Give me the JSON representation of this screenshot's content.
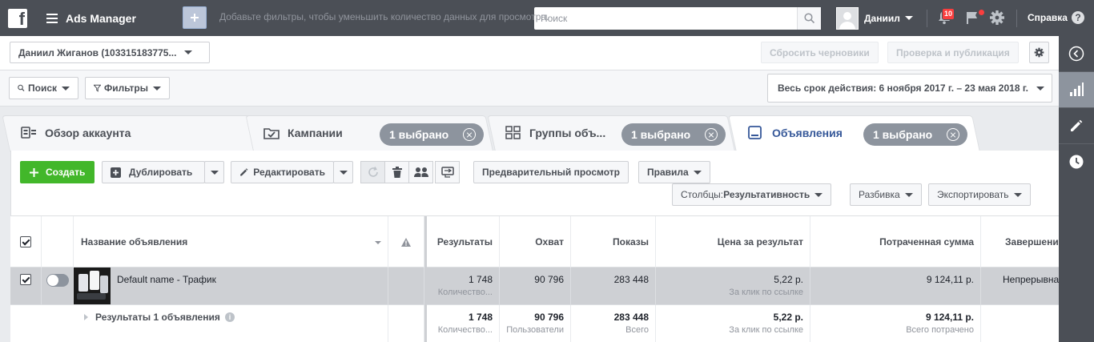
{
  "topbar": {
    "app_title": "Ads Manager",
    "search_placeholder": "Поиск",
    "user_name": "Даниил",
    "notification_count": "10",
    "help_label": "Справка",
    "help_glyph": "?"
  },
  "account_bar": {
    "account_name": "Даниил Жиганов (103315183775...",
    "discard_label": "Сбросить черновики",
    "review_label": "Проверка и публикация"
  },
  "filter_bar": {
    "search_label": "Поиск",
    "filters_label": "Фильтры",
    "hint": "Добавьте фильтры, чтобы уменьшить количество данных для просмотра.",
    "date_range": "Весь срок действия: 6 ноября 2017 г. – 23 мая 2018 г."
  },
  "tabs": [
    {
      "label": "Обзор аккаунта"
    },
    {
      "label": "Кампании",
      "selected": "1 выбрано"
    },
    {
      "label": "Группы объ...",
      "selected": "1 выбрано"
    },
    {
      "label": "Объявления",
      "selected": "1 выбрано"
    }
  ],
  "toolbar": {
    "create_label": "Создать",
    "duplicate_label": "Дублировать",
    "edit_label": "Редактировать",
    "preview_label": "Предварительный просмотр",
    "rules_label": "Правила",
    "columns_prefix": "Столбцы: ",
    "columns_value": "Результативность",
    "breakdown_label": "Разбивка",
    "export_label": "Экспортировать"
  },
  "table": {
    "headers": {
      "name": "Название объявления",
      "results": "Результаты",
      "reach": "Охват",
      "impressions": "Показы",
      "cost_per_result": "Цена за результат",
      "amount_spent": "Потраченная сумма",
      "ends": "Завершение"
    },
    "row": {
      "name": "Default name - Трафик",
      "results": "1 748",
      "results_sub": "Количество...",
      "reach": "90 796",
      "impressions": "283 448",
      "cost": "5,22 р.",
      "cost_sub": "За клик по ссылке",
      "spent": "9 124,11 р.",
      "ends": "Непрерывная"
    },
    "totals": {
      "label": "Результаты 1 объявления",
      "results": "1 748",
      "results_sub": "Количество...",
      "reach": "90 796",
      "reach_sub": "Пользователи",
      "impressions": "283 448",
      "impressions_sub": "Всего",
      "cost": "5,22 р.",
      "cost_sub": "За клик по ссылке",
      "spent": "9 124,11 р.",
      "spent_sub": "Всего потрачено"
    }
  },
  "colors": {
    "topbar": "#4b4f56",
    "create_green": "#42b72a",
    "active_tab": "#365899",
    "selected_row": "#ced0d4"
  }
}
